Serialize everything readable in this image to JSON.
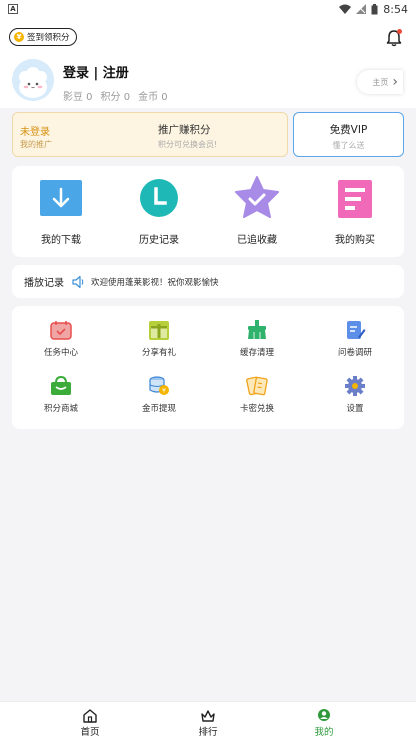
{
  "status_bar": {
    "app_letter": "A",
    "time": "8:54"
  },
  "header": {
    "signin_label": "签到领积分",
    "signin_coin": "¥",
    "login_title": "登录 | 注册",
    "stats": [
      "影豆 0",
      "积分 0",
      "金币 0"
    ],
    "homepage_label": "主页"
  },
  "promo": {
    "status": "未登录",
    "status_sub": "我的推广",
    "title": "推广赚积分",
    "desc": "积分可兑换会员!",
    "vip_title": "免费VIP",
    "vip_sub": "懂了么送"
  },
  "main_grid": [
    "我的下载",
    "历史记录",
    "已追收藏",
    "我的购买"
  ],
  "play_record": {
    "title": "播放记录",
    "notice": "欢迎使用蓬莱影视！祝你观影愉快"
  },
  "tools": [
    "任务中心",
    "分享有礼",
    "缓存清理",
    "问卷调研",
    "积分商城",
    "金币提现",
    "卡密兑换",
    "设置"
  ],
  "bottom_nav": [
    "首页",
    "排行",
    "我的"
  ],
  "colors": {
    "accent": "#2e9a3c",
    "vip_border": "#5aa6e8",
    "promo_bg": "#fdf5e2",
    "promo_text": "#d59010"
  }
}
